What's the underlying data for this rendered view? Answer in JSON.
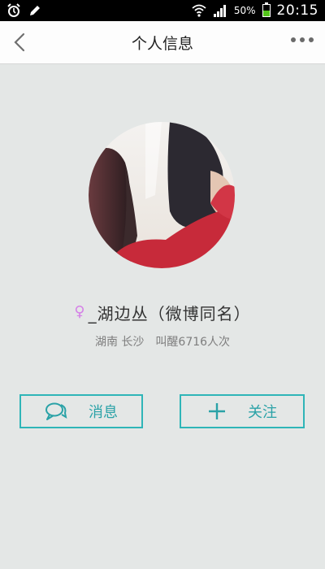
{
  "status_bar": {
    "battery_percent": "50%",
    "battery_level": 0.5,
    "time": "20:15",
    "icons": [
      "alarm-icon",
      "pen-icon",
      "wifi-icon",
      "signal-icon",
      "battery-icon"
    ]
  },
  "header": {
    "title": "个人信息",
    "back_icon": "chevron-left-icon",
    "more_icon": "more-dots-icon"
  },
  "profile": {
    "gender_icon": "♀",
    "username": "_湖边丛（微博同名）",
    "location": "湖南 长沙",
    "wakeups": "叫醒6716人次"
  },
  "actions": {
    "message_label": "消息",
    "follow_label": "关注"
  },
  "colors": {
    "accent": "#2fb5b8",
    "female": "#d580e7",
    "background": "#e4e7e6"
  }
}
